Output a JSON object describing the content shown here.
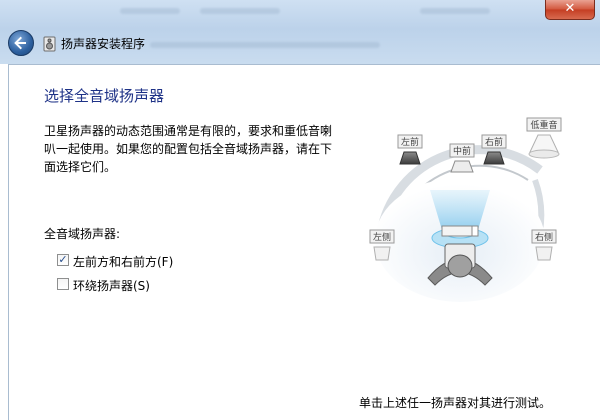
{
  "window": {
    "title": "扬声器安装程序",
    "close_glyph": "✕",
    "back_icon": "back-arrow-icon",
    "app_icon": "speaker-setup-icon"
  },
  "page": {
    "heading": "选择全音域扬声器",
    "description": "卫星扬声器的动态范围通常是有限的，要求和重低音喇\n叭一起使用。如果您的配置包括全音域扬声器，请在下\n面选择它们。",
    "group_label": "全音域扬声器:",
    "options": [
      {
        "label": "左前方和右前方(F)",
        "checked": true
      },
      {
        "label": "环绕扬声器(S)",
        "checked": false
      }
    ],
    "footer_hint": "单击上述任一扬声器对其进行测试。"
  },
  "speakers": {
    "front_left": "左前",
    "center": "中前",
    "front_right": "右前",
    "subwoofer": "低重音",
    "side_left": "左侧",
    "side_right": "右侧"
  },
  "colors": {
    "heading": "#1e3287",
    "accent": "#2c5f9e",
    "close": "#c43d22"
  }
}
